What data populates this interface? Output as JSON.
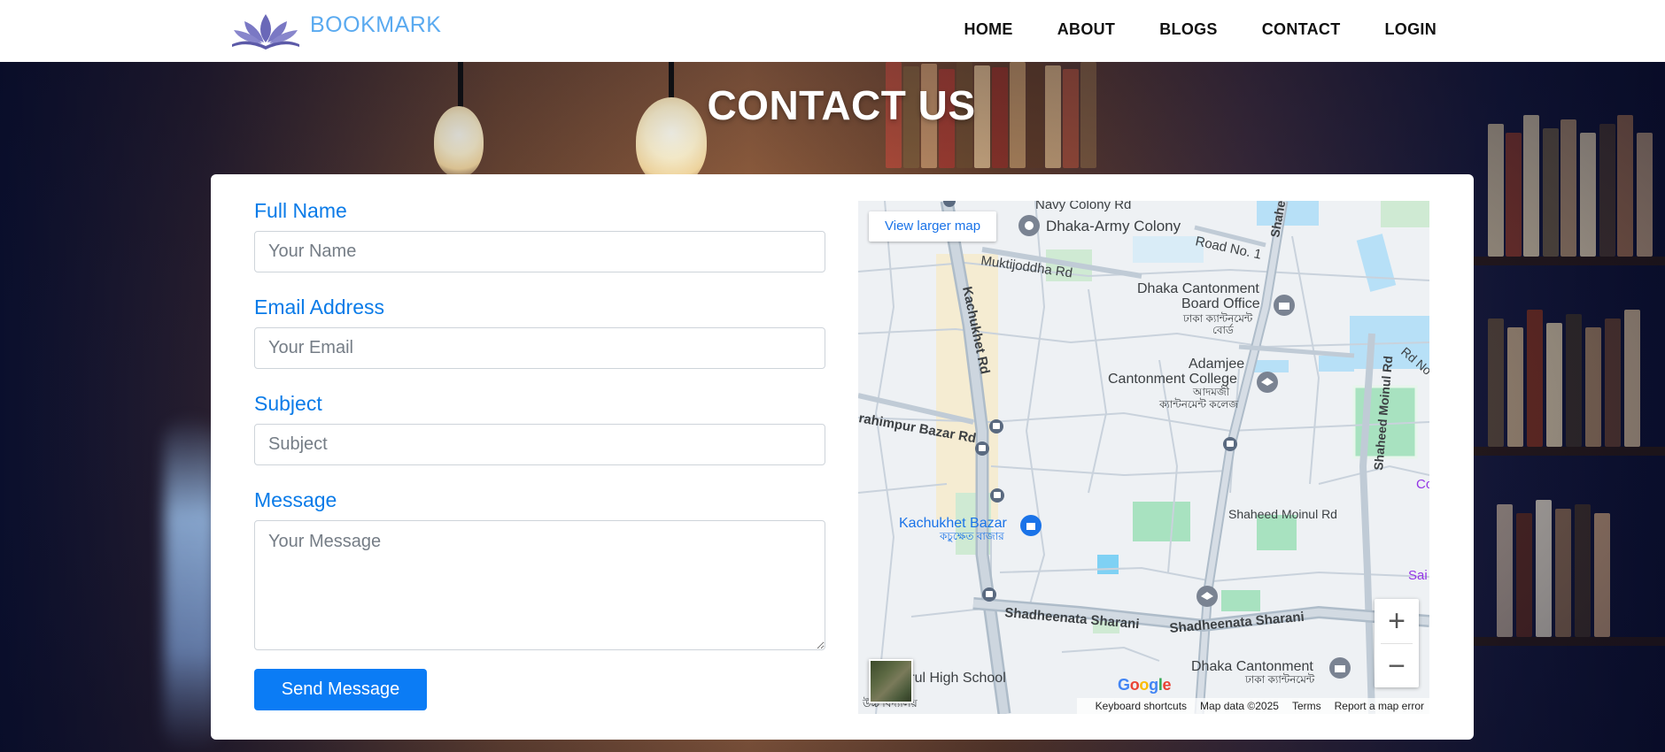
{
  "brand": {
    "name": "BOOKMARK"
  },
  "nav": {
    "items": [
      "HOME",
      "ABOUT",
      "BLOGS",
      "CONTACT",
      "LOGIN"
    ]
  },
  "page": {
    "title": "CONTACT US"
  },
  "form": {
    "full_name": {
      "label": "Full Name",
      "placeholder": "Your Name",
      "value": ""
    },
    "email": {
      "label": "Email Address",
      "placeholder": "Your Email",
      "value": ""
    },
    "subject": {
      "label": "Subject",
      "placeholder": "Subject",
      "value": ""
    },
    "message": {
      "label": "Message",
      "placeholder": "Your Message",
      "value": ""
    },
    "submit_label": "Send Message"
  },
  "map": {
    "view_larger": "View larger map",
    "zoom_in": "+",
    "zoom_out": "−",
    "labels": {
      "navy_colony": "Navy Colony Rd",
      "dhaka_army": "Dhaka-Army Colony",
      "road1": "Road No. 1",
      "muktijoddha": "Muktijoddha Rd",
      "kachukhet_rd": "Kachukhet Rd",
      "cantonment_board": "Dhaka Cantonment",
      "cantonment_board2": "Board Office",
      "cantonment_board_bn": "ঢাকা ক্যান্টনমেন্ট",
      "cantonment_board_bn2": "বোর্ড",
      "adamjee": "Adamjee",
      "adamjee2": "Cantonment College",
      "adamjee_bn": "আদমজী",
      "adamjee_bn2": "ক্যান্টনমেন্ট কলেজ",
      "shaheed_moinul_v": "Shaheed Moinul Rd",
      "ibrahimpur": "rahimpur Bazar Rd",
      "kachukhet_bazar": "Kachukhet Bazar",
      "kachukhet_bazar_bn": "কচুক্ষেত বাজার",
      "shaheed_moinul_h": "Shaheed Moinul Rd",
      "shadheenata1": "Shadheenata Sharani",
      "shadheenata2": "Shadheenata Sharani",
      "dhaka_cantonment": "Dhaka Cantonment",
      "dhaka_cantonment_bn": "ঢাকা ক্যান্টনমেন্ট",
      "school": "Ashrafrul High School",
      "school_bn": "উচ্চ বিদ্যালয়",
      "shaheed_v": "Shahee",
      "road_ne": "Rd No",
      "co": "Co",
      "sai": "Sai"
    },
    "google": "Google",
    "attribution": [
      "Keyboard shortcuts",
      "Map data ©2025",
      "Terms",
      "Report a map error"
    ]
  }
}
